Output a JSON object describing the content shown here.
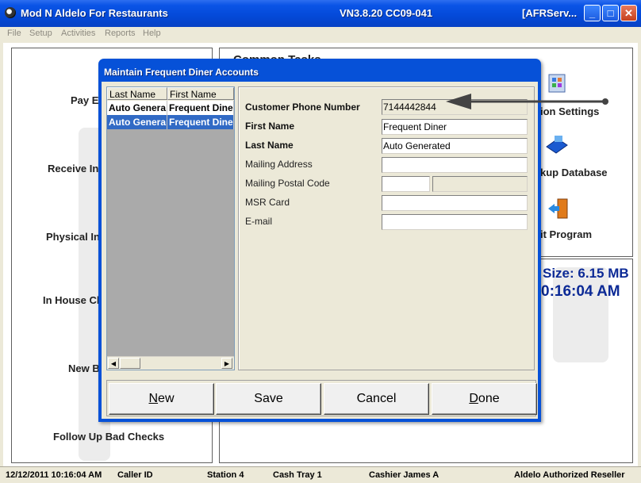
{
  "window": {
    "title": "Mod N Aldelo For Restaurants",
    "version": "VN3.8.20  CC09-041",
    "server": "[AFRServ...",
    "minimize_glyph": "_",
    "maximize_glyph": "□",
    "close_glyph": "✕"
  },
  "menu": [
    "File",
    "Setup",
    "Activities",
    "Reports",
    "Help"
  ],
  "left_panel": {
    "items": [
      "Pay E",
      "Receive In",
      "Physical In",
      "In House Cl",
      "New B",
      "Follow Up Bad Checks"
    ]
  },
  "common_tasks": {
    "heading": "Common Tasks",
    "items": [
      "ion Settings",
      "kup Database",
      "it Program"
    ]
  },
  "info_panel": {
    "size": "Size: 6.15 MB",
    "time": "0:16:04 AM"
  },
  "status_bar": {
    "datetime": "12/12/2011 10:16:04 AM",
    "caller": "Caller ID",
    "station": "Station 4",
    "cash_tray": "Cash Tray 1",
    "cashier": "Cashier James A",
    "reseller": "Aldelo Authorized Reseller"
  },
  "dialog": {
    "title": "Maintain Frequent Diner Accounts",
    "list": {
      "columns": [
        "Last Name",
        "First Name"
      ],
      "rows": [
        {
          "last": "Auto Genera",
          "first": "Frequent Diner"
        },
        {
          "last": "Auto Genera",
          "first": "Frequent Diner"
        }
      ],
      "scroll_left": "◀",
      "scroll_right": "▶"
    },
    "form": {
      "phone_label": "Customer Phone Number",
      "phone_value": "7144442844",
      "first_name_label": "First Name",
      "first_name_value": "Frequent Diner",
      "last_name_label": "Last Name",
      "last_name_value": "Auto Generated",
      "address_label": "Mailing Address",
      "address_value": "",
      "postal_label": "Mailing Postal Code",
      "postal_value": "",
      "msr_label": "MSR Card",
      "msr_value": "",
      "email_label": "E-mail",
      "email_value": ""
    },
    "buttons": {
      "new_u": "N",
      "new_rest": "ew",
      "save": "Save",
      "cancel": "Cancel",
      "done_u": "D",
      "done_rest": "one"
    }
  },
  "colors": {
    "title_blue": "#0449d8",
    "selection": "#316ac5",
    "info_text": "#0c2a96"
  }
}
